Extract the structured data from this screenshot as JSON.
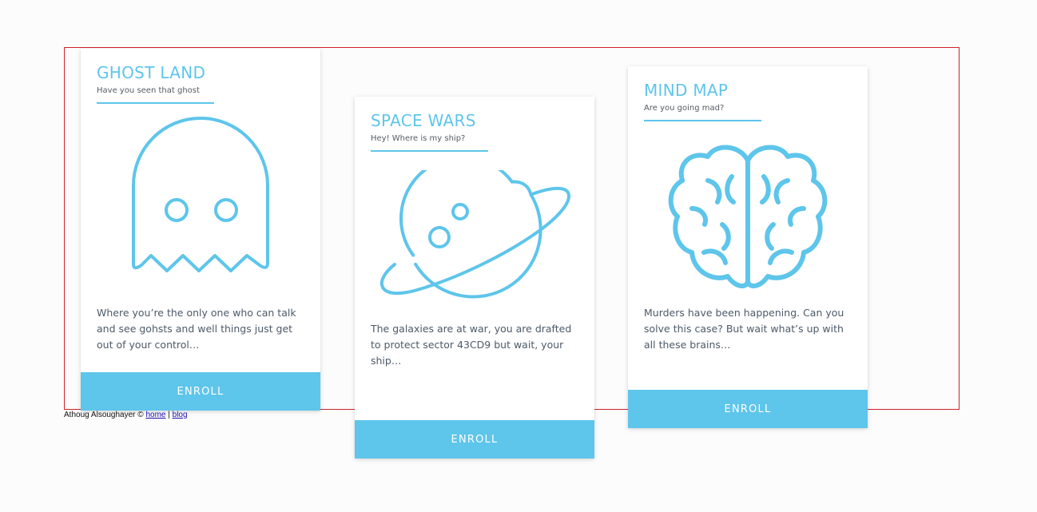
{
  "colors": {
    "accent": "#5ec5eb",
    "frame_border": "#d0212b",
    "card_background": "#ffffff",
    "page_background": "#fcfcfc"
  },
  "cards": [
    {
      "title": "GHOST LAND",
      "subtitle": "Have you seen that ghost",
      "icon": "ghost-icon",
      "description": "Where you’re the only one who can talk and see gohsts and well things just get out of your control…",
      "button_label": "ENROLL"
    },
    {
      "title": "SPACE WARS",
      "subtitle": "Hey! Where is my ship?",
      "icon": "planet-icon",
      "description": "The galaxies are at war, you are drafted to protect sector 43CD9 but wait, your ship…",
      "button_label": "ENROLL"
    },
    {
      "title": "MIND MAP",
      "subtitle": "Are you going mad?",
      "icon": "brain-icon",
      "description": "Murders have been happening. Can you solve this case? But wait what’s up with all these brains…",
      "button_label": "ENROLL"
    }
  ],
  "footer": {
    "author": "Athoug Alsoughayer ©",
    "home_link": "home",
    "separator": "|",
    "blog_link": "blog"
  }
}
